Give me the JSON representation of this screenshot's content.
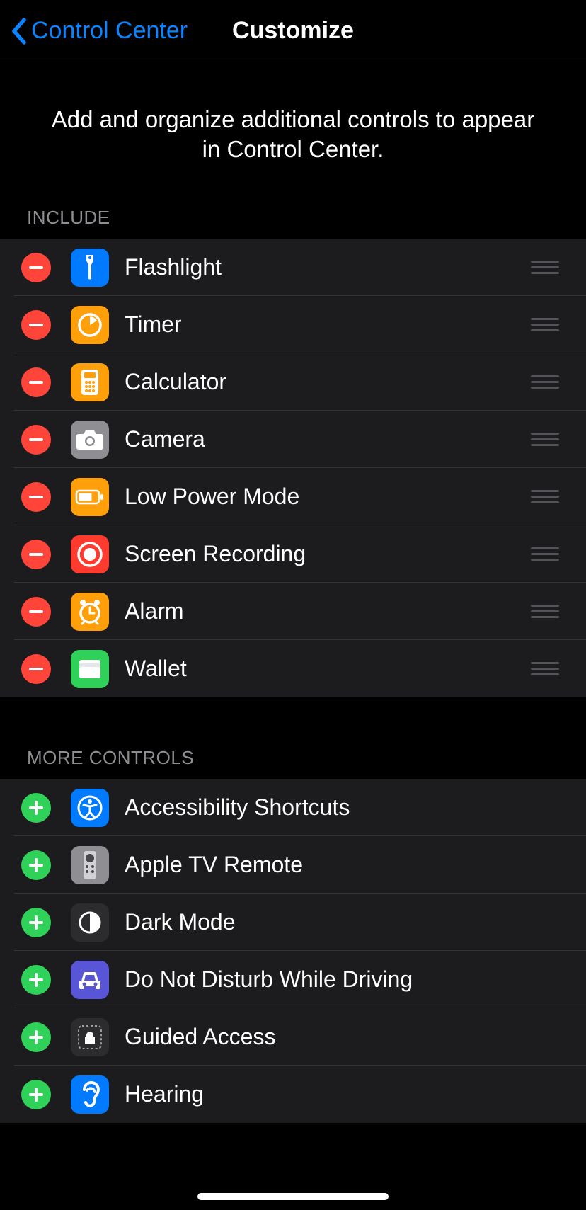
{
  "nav": {
    "back_label": "Control Center",
    "title": "Customize"
  },
  "description": "Add and organize additional controls to appear in Control Center.",
  "include": {
    "header": "Include",
    "items": [
      {
        "label": "Flashlight",
        "slug": "flashlight",
        "bg": "#007aff"
      },
      {
        "label": "Timer",
        "slug": "timer",
        "bg": "#ff9f0a"
      },
      {
        "label": "Calculator",
        "slug": "calculator",
        "bg": "#ff9f0a"
      },
      {
        "label": "Camera",
        "slug": "camera",
        "bg": "#8e8e93"
      },
      {
        "label": "Low Power Mode",
        "slug": "low-power-mode",
        "bg": "#ff9f0a"
      },
      {
        "label": "Screen Recording",
        "slug": "screen-recording",
        "bg": "#ff3b30"
      },
      {
        "label": "Alarm",
        "slug": "alarm",
        "bg": "#ff9f0a"
      },
      {
        "label": "Wallet",
        "slug": "wallet",
        "bg": "#30d158"
      }
    ]
  },
  "more": {
    "header": "More Controls",
    "items": [
      {
        "label": "Accessibility Shortcuts",
        "slug": "accessibility-shortcuts",
        "bg": "#007aff"
      },
      {
        "label": "Apple TV Remote",
        "slug": "apple-tv-remote",
        "bg": "#8e8e93"
      },
      {
        "label": "Dark Mode",
        "slug": "dark-mode",
        "bg": "#2c2c2e"
      },
      {
        "label": "Do Not Disturb While Driving",
        "slug": "dnd-while-driving",
        "bg": "#5856d6"
      },
      {
        "label": "Guided Access",
        "slug": "guided-access",
        "bg": "#2c2c2e"
      },
      {
        "label": "Hearing",
        "slug": "hearing",
        "bg": "#007aff"
      }
    ]
  }
}
